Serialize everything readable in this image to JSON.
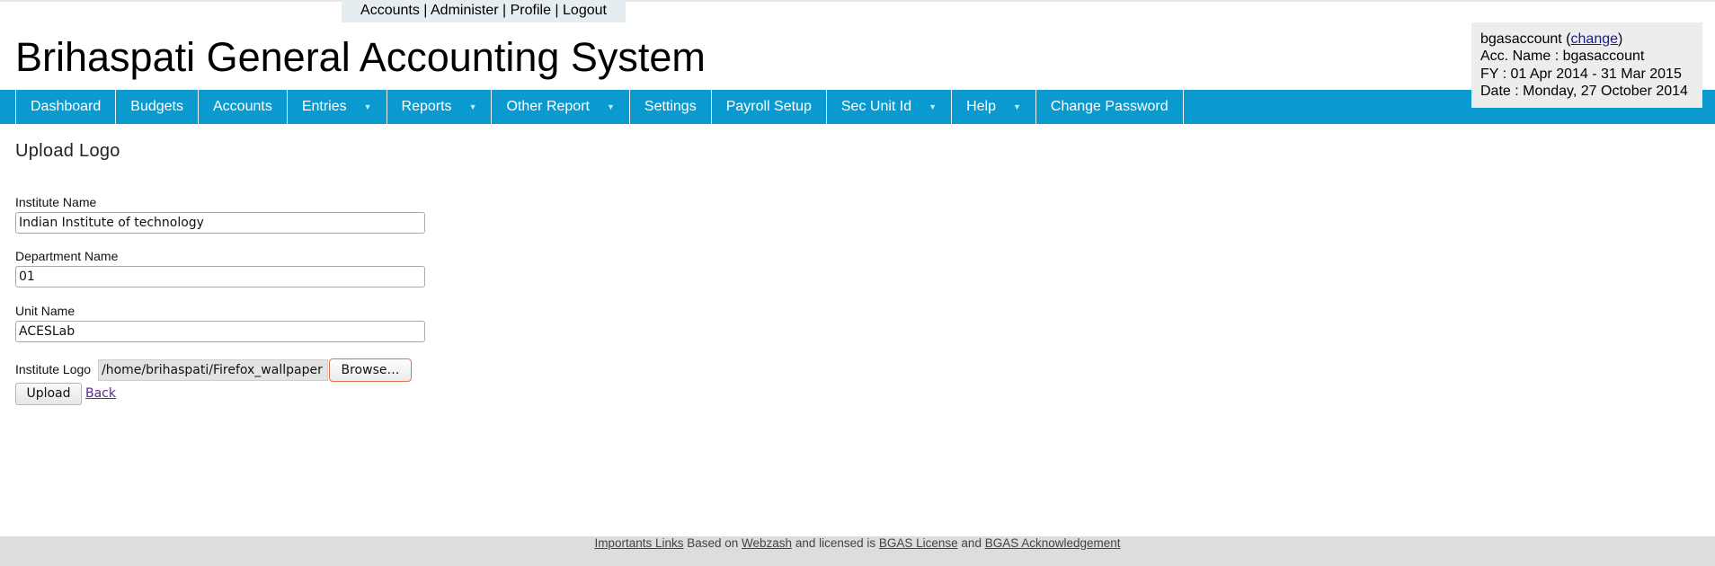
{
  "top_links": {
    "accounts": "Accounts",
    "administer": "Administer",
    "profile": "Profile",
    "logout": "Logout",
    "separator": " | "
  },
  "app_title": "Brihaspati General Accounting System",
  "account_box": {
    "account_name": "bgasaccount",
    "change_prefix": " (",
    "change_link": "change",
    "change_suffix": ")",
    "acc_name_line": "Acc. Name : bgasaccount",
    "fy_line": "FY : 01 Apr 2014 - 31 Mar 2015",
    "date_line": "Date : Monday, 27 October 2014"
  },
  "nav": {
    "items": [
      {
        "label": "Dashboard",
        "dropdown": false
      },
      {
        "label": "Budgets",
        "dropdown": false
      },
      {
        "label": "Accounts",
        "dropdown": false
      },
      {
        "label": "Entries",
        "dropdown": true
      },
      {
        "label": "Reports",
        "dropdown": true
      },
      {
        "label": "Other Report",
        "dropdown": true
      },
      {
        "label": "Settings",
        "dropdown": false
      },
      {
        "label": "Payroll Setup",
        "dropdown": false
      },
      {
        "label": "Sec Unit Id",
        "dropdown": true
      },
      {
        "label": "Help",
        "dropdown": true
      },
      {
        "label": "Change Password",
        "dropdown": false
      }
    ],
    "caret_glyph": "▼",
    "bar_color": "#0a9ad0"
  },
  "form": {
    "heading": "Upload Logo",
    "institute_label": "Institute Name",
    "institute_value": "Indian Institute of technology",
    "department_label": "Department Name",
    "department_value": "01",
    "unit_label": "Unit Name",
    "unit_value": "ACESLab",
    "logo_label": "Institute Logo",
    "file_path": "/home/brihaspati/Firefox_wallpaper",
    "browse_label": "Browse…",
    "upload_label": "Upload",
    "back_label": "Back"
  },
  "footer": {
    "important_links": "Importants Links",
    "based_on": " Based on ",
    "webzash": "Webzash",
    "licensed": " and licensed is ",
    "license": "BGAS License",
    "and": " and ",
    "acknowledgement": "BGAS Acknowledgement"
  }
}
